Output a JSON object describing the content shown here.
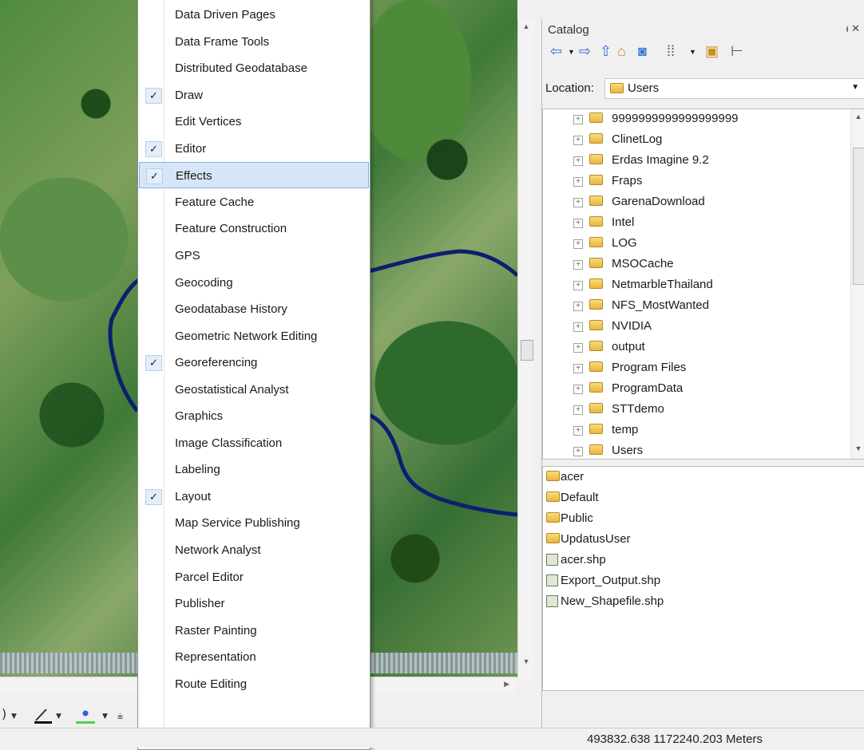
{
  "menu": {
    "items": [
      {
        "label": "Data Driven Pages",
        "checked": false
      },
      {
        "label": "Data Frame Tools",
        "checked": false
      },
      {
        "label": "Distributed Geodatabase",
        "checked": false
      },
      {
        "label": "Draw",
        "checked": true
      },
      {
        "label": "Edit Vertices",
        "checked": false
      },
      {
        "label": "Editor",
        "checked": true
      },
      {
        "label": "Effects",
        "checked": true,
        "highlighted": true
      },
      {
        "label": "Feature Cache",
        "checked": false
      },
      {
        "label": "Feature Construction",
        "checked": false
      },
      {
        "label": "GPS",
        "checked": false
      },
      {
        "label": "Geocoding",
        "checked": false
      },
      {
        "label": "Geodatabase History",
        "checked": false
      },
      {
        "label": "Geometric Network Editing",
        "checked": false
      },
      {
        "label": "Georeferencing",
        "checked": true
      },
      {
        "label": "Geostatistical Analyst",
        "checked": false
      },
      {
        "label": "Graphics",
        "checked": false
      },
      {
        "label": "Image Classification",
        "checked": false
      },
      {
        "label": "Labeling",
        "checked": false
      },
      {
        "label": "Layout",
        "checked": true
      },
      {
        "label": "Map Service Publishing",
        "checked": false
      },
      {
        "label": "Network Analyst",
        "checked": false
      },
      {
        "label": "Parcel Editor",
        "checked": false
      },
      {
        "label": "Publisher",
        "checked": false
      },
      {
        "label": "Raster Painting",
        "checked": false
      },
      {
        "label": "Representation",
        "checked": false
      },
      {
        "label": "Route Editing",
        "checked": false
      }
    ],
    "check_glyph": "✓",
    "more_glyph": "▼"
  },
  "catalog": {
    "title": "Catalog",
    "pin_close": "ᵻ ✕",
    "location_label": "Location:",
    "location_value": "Users",
    "tree": [
      "9999999999999999999",
      "ClinetLog",
      "Erdas Imagine 9.2",
      "Fraps",
      "GarenaDownload",
      "Intel",
      "LOG",
      "MSOCache",
      "NetmarbleThailand",
      "NFS_MostWanted",
      "NVIDIA",
      "output",
      "Program Files",
      "ProgramData",
      "STTdemo",
      "temp",
      "Users"
    ],
    "contents": [
      {
        "label": "acer",
        "type": "folder"
      },
      {
        "label": "Default",
        "type": "folder"
      },
      {
        "label": "Public",
        "type": "folder"
      },
      {
        "label": "UpdatusUser",
        "type": "folder"
      },
      {
        "label": "acer.shp",
        "type": "shapefile"
      },
      {
        "label": "Export_Output.shp",
        "type": "shapefile"
      },
      {
        "label": "New_Shapefile.shp",
        "type": "shapefile"
      }
    ]
  },
  "status": {
    "coordinates": "493832.638  1172240.203 Meters"
  },
  "colors": {
    "boundary_line": "#0d1f6e",
    "menu_highlight": "#d6e6f7"
  }
}
